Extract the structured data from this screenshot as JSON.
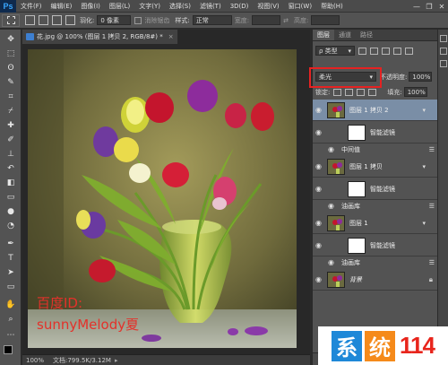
{
  "app": {
    "logo": "Ps"
  },
  "menu": [
    "文件(F)",
    "编辑(E)",
    "图像(I)",
    "图层(L)",
    "文字(Y)",
    "选择(S)",
    "滤镜(T)",
    "3D(D)",
    "视图(V)",
    "窗口(W)",
    "帮助(H)"
  ],
  "window_controls": {
    "minimize": "—",
    "restore": "❐",
    "close": "✕"
  },
  "options": {
    "feather_label": "羽化:",
    "feather_value": "0 像素",
    "antialias_label": "消除锯齿",
    "style_label": "样式:",
    "style_value": "正常",
    "width_label": "宽度:",
    "height_label": "高度:"
  },
  "document": {
    "tab_title": "花.jpg @ 100% (图层 1 拷贝 2, RGB/8#) *",
    "tab_close": "×",
    "zoom": "100%",
    "doc_info": "文档:799.5K/3.12M",
    "watermark_line1": "百度ID:",
    "watermark_line2": "sunnyMelody夏"
  },
  "panel": {
    "tabs": [
      "图层",
      "通道",
      "路径"
    ],
    "kind_label": "ρ 类型",
    "blend_mode": "柔光",
    "opacity_label": "不透明度:",
    "opacity_value": "100%",
    "lock_label": "锁定:",
    "fill_label": "填充:",
    "fill_value": "100%"
  },
  "layers": [
    {
      "name": "图层 1 拷贝 2",
      "selected": true
    },
    {
      "name": "智能滤镜",
      "kind": "smart-filter"
    },
    {
      "name": "中间值",
      "kind": "filter"
    },
    {
      "name": "图层 1 拷贝"
    },
    {
      "name": "智能滤镜",
      "kind": "smart-filter"
    },
    {
      "name": "油画库",
      "kind": "filter"
    },
    {
      "name": "图层 1"
    },
    {
      "name": "智能滤镜",
      "kind": "smart-filter"
    },
    {
      "name": "油画库",
      "kind": "filter"
    },
    {
      "name": "背景",
      "locked": true
    }
  ],
  "layer_names": {
    "l1": "图层 1 拷贝 2",
    "l1_smart": "智能滤镜",
    "l1_filter": "中间值",
    "l2": "图层 1 拷贝",
    "l2_smart": "智能滤镜",
    "l2_filter": "油画库",
    "l3": "图层 1",
    "l3_smart": "智能滤镜",
    "l3_filter": "油画库",
    "bg": "背景"
  },
  "corner_logo": {
    "char1": "系",
    "char2": "统",
    "num": "114"
  },
  "colors": {
    "selected_layer": "#7a8ea6",
    "highlight_box": "#e62222",
    "watermark": "#e4312a",
    "logo_blue": "#1e88d8",
    "logo_orange": "#f58a1a"
  }
}
